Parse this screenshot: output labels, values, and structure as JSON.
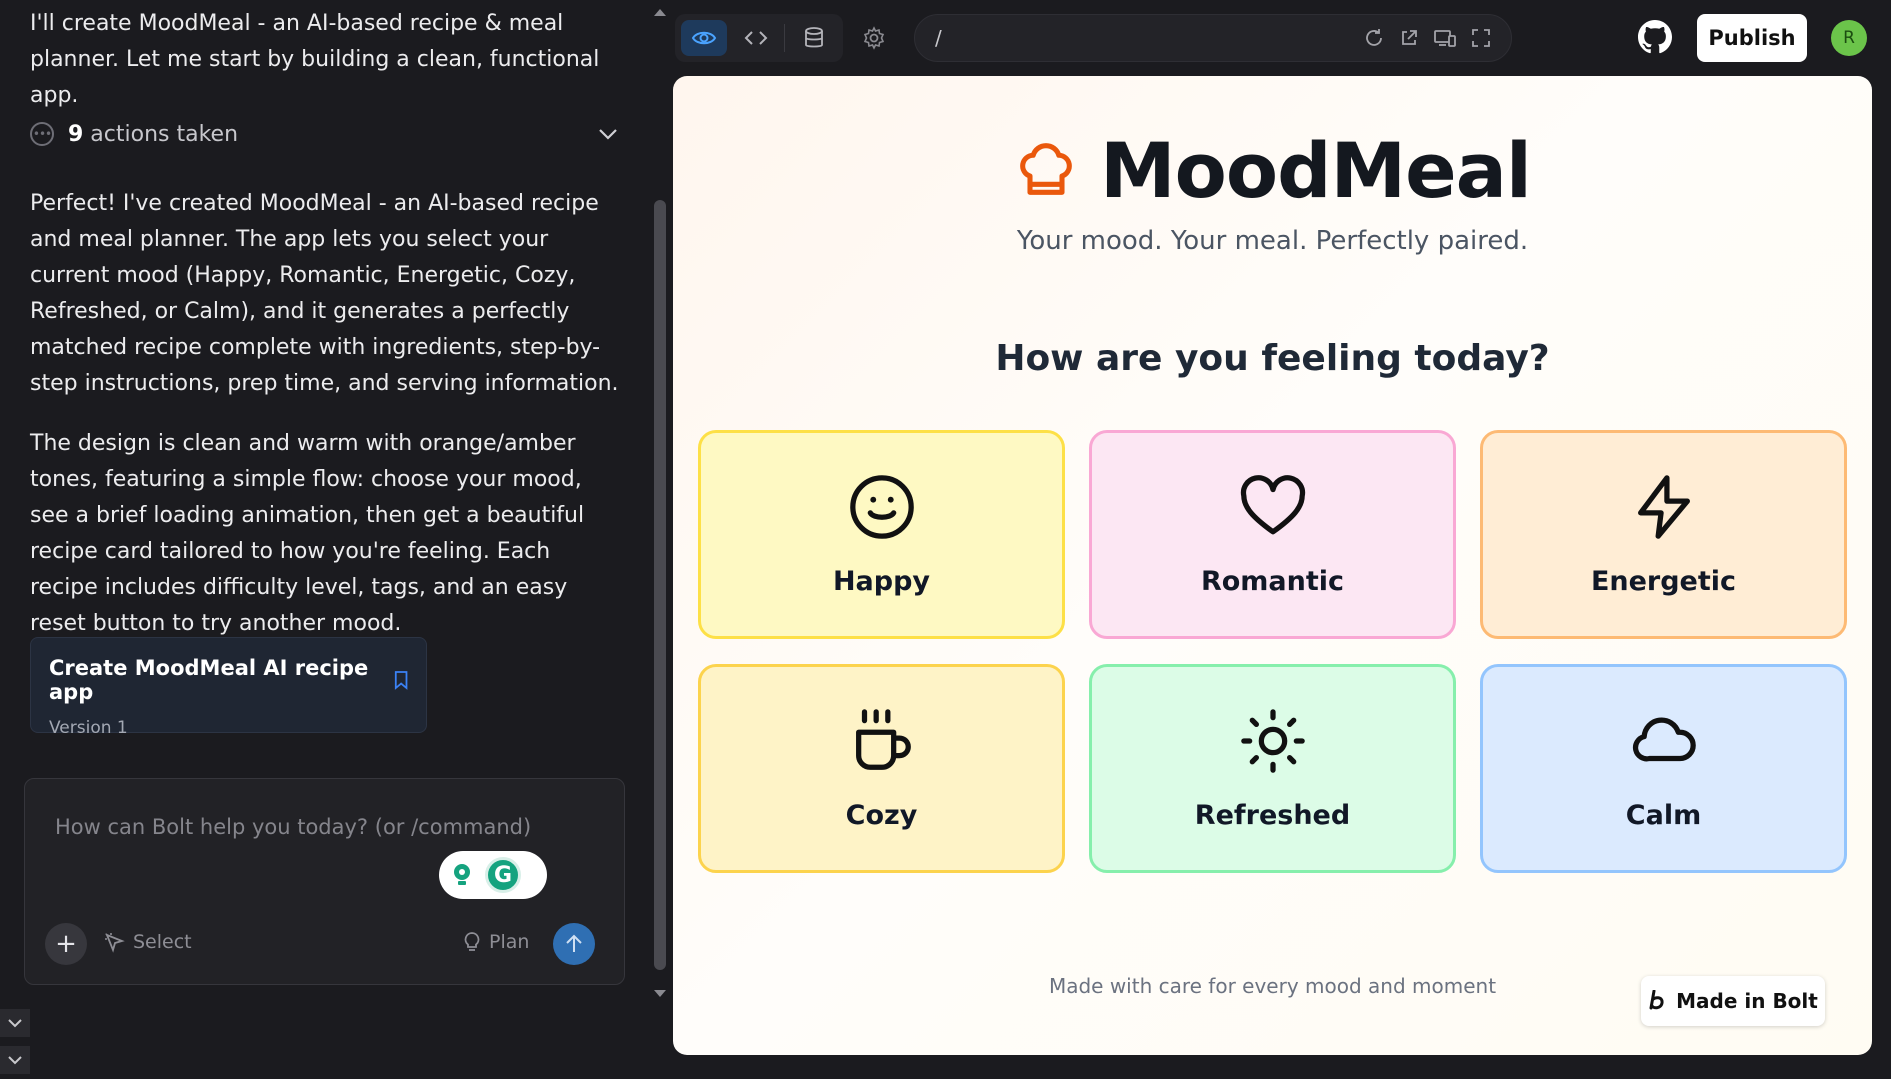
{
  "chat": {
    "intro": "I'll create MoodMeal - an AI-based recipe & meal planner. Let me start by building a clean, functional app.",
    "actions_count": "9",
    "actions_label": " actions taken",
    "para1": "Perfect! I've created MoodMeal - an AI-based recipe and meal planner. The app lets you select your current mood (Happy, Romantic, Energetic, Cozy, Refreshed, or Calm), and it generates a perfectly matched recipe complete with ingredients, step-by-step instructions, prep time, and serving information.",
    "para2": "The design is clean and warm with orange/amber tones, featuring a simple flow: choose your mood, see a brief loading animation, then get a beautiful recipe card tailored to how you're feeling. Each recipe includes difficulty level, tags, and an easy reset button to try another mood.",
    "version_title": "Create MoodMeal AI recipe app",
    "version_sub": "Version 1",
    "composer_placeholder": "How can Bolt help you today? (or /command)",
    "select_label": "Select",
    "plan_label": "Plan"
  },
  "toolbar": {
    "url_path": "/",
    "publish_label": "Publish",
    "avatar_initial": "R"
  },
  "app": {
    "title": "MoodMeal",
    "tagline": "Your mood. Your meal. Perfectly paired.",
    "question": "How are you feeling today?",
    "moods": [
      {
        "label": "Happy",
        "icon": "smile-icon",
        "bg": "#fef9c3",
        "border": "#fde047"
      },
      {
        "label": "Romantic",
        "icon": "heart-icon",
        "bg": "#fce7f3",
        "border": "#f9a8d4"
      },
      {
        "label": "Energetic",
        "icon": "zap-icon",
        "bg": "#ffedd5",
        "border": "#fdba74"
      },
      {
        "label": "Cozy",
        "icon": "coffee-icon",
        "bg": "#fef3c7",
        "border": "#fcd34d"
      },
      {
        "label": "Refreshed",
        "icon": "sun-icon",
        "bg": "#dcfce7",
        "border": "#86efac"
      },
      {
        "label": "Calm",
        "icon": "cloud-icon",
        "bg": "#dbeafe",
        "border": "#93c5fd"
      }
    ],
    "footer": "Made with care for every mood and moment",
    "badge": "Made in Bolt",
    "accent": "#ea580c"
  }
}
